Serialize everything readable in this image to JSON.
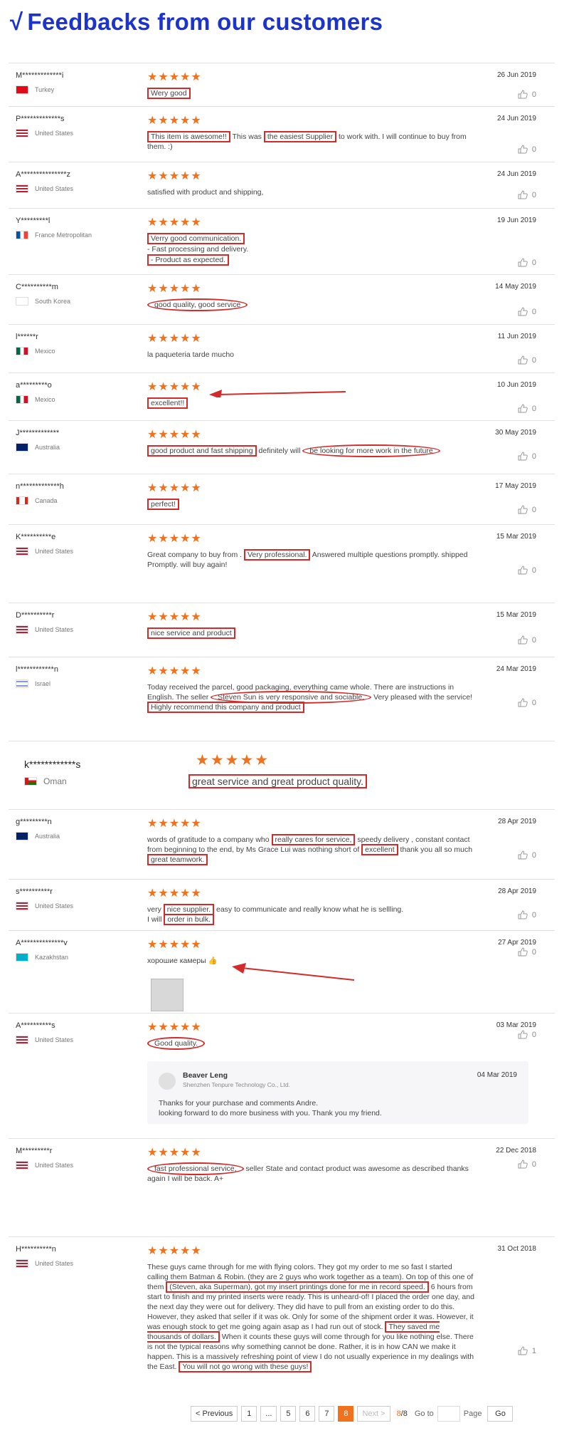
{
  "header": {
    "check": "√",
    "title": "Feedbacks from our customers"
  },
  "stars": "★★★★★",
  "reviews": [
    {
      "user": "M*************i",
      "country": "Turkey",
      "date": "26 Jun 2019",
      "likes": "0",
      "text": "Wery good"
    },
    {
      "user": "P*************s",
      "country": "United States",
      "date": "24 Jun 2019",
      "likes": "0",
      "text_parts": [
        "This item is awesome!!",
        " This was ",
        "the easiest Supplier",
        " to work with. I will continue to buy from them. :)"
      ]
    },
    {
      "user": "A***************z",
      "country": "United States",
      "date": "24 Jun 2019",
      "likes": "0",
      "text": "satisfied with product and shipping,"
    },
    {
      "user": "Y*********l",
      "country": "France Metropolitan",
      "date": "19 Jun 2019",
      "likes": "0",
      "lines": [
        "Verry good communication.",
        "- Fast processing and delivery.",
        "- Product as expected."
      ]
    },
    {
      "user": "C**********m",
      "country": "South Korea",
      "date": "14 May 2019",
      "likes": "0",
      "text": "good quality, good service"
    },
    {
      "user": "l******r",
      "country": "Mexico",
      "date": "11 Jun 2019",
      "likes": "0",
      "text": "la paqueteria tarde mucho"
    },
    {
      "user": "a*********o",
      "country": "Mexico",
      "date": "10 Jun 2019",
      "likes": "0",
      "text": "excellent!!"
    },
    {
      "user": "J*************",
      "country": "Australia",
      "date": "30 May 2019",
      "likes": "0",
      "text_parts": [
        "good product and fast shipping",
        " definitely will ",
        "be looking for more work in the future"
      ]
    },
    {
      "user": "n*************h",
      "country": "Canada",
      "date": "17 May 2019",
      "likes": "0",
      "text": "perfect!"
    },
    {
      "user": "K**********e",
      "country": "United States",
      "date": "15 Mar 2019",
      "likes": "0",
      "text_parts": [
        "Great company to buy from . ",
        "Very professional.",
        " Answered multiple questions promptly. shipped Promptly. will buy again!"
      ]
    },
    {
      "user": "D**********r",
      "country": "United States",
      "date": "15 Mar 2019",
      "likes": "0",
      "text": "nice service and product"
    },
    {
      "user": "l************n",
      "country": "Israel",
      "date": "24 Mar 2019",
      "likes": "0",
      "text_parts": [
        "Today received the parcel, good packaging, everything came whole. There are instructions in English. The seller ",
        "Steven Sun  is very responsive and sociable.",
        " Very pleased with the service! ",
        "Highly recommend this company and product"
      ]
    },
    {
      "user": "k************s",
      "country": "Oman",
      "text": "great service and great product quality."
    },
    {
      "user": "g*********n",
      "country": "Australia",
      "date": "28 Apr 2019",
      "likes": "0",
      "text_parts": [
        "words of gratitude to a company who ",
        "really cares for service,",
        " speedy delivery , constant contact from beginning to the end, by Ms Grace Lui was nothing short of ",
        "excellent",
        " thank you all so much ",
        "great teamwork."
      ]
    },
    {
      "user": "s**********r",
      "country": "United States",
      "date": "28 Apr 2019",
      "likes": "0",
      "text_parts": [
        "very ",
        "nice supplier.",
        " easy to communicate and really know what he is sellling.",
        "I will ",
        "order in bulk."
      ]
    },
    {
      "user": "A**************v",
      "country": "Kazakhstan",
      "date": "27 Apr 2019",
      "likes": "0",
      "text": "хорошие камеры 👍"
    },
    {
      "user": "A**********s",
      "country": "United States",
      "date": "03 Mar 2019",
      "likes": "0",
      "text": "Good quality."
    },
    {
      "user": "M*********r",
      "country": "United States",
      "date": "22 Dec 2018",
      "likes": "0",
      "text_parts": [
        "fast professional service,",
        " seller State and contact product was awesome as described thanks again I will be back. A+"
      ]
    },
    {
      "user": "H**********n",
      "country": "United States",
      "date": "31 Oct 2018",
      "likes": "1",
      "text_parts": [
        "These guys came through for me with flying colors. They got my order to me so fast I started calling them Batman & Robin. (they are 2 guys who work together as a team). On top of this one of them ",
        "(Steven, aka Superman), got my insert printings done for me in record speed.",
        " 6 hours from start to finish and my printed inserts were ready. This is unheard-of! I placed the order one day, and the next day they were out for delivery. They did have to pull from an existing order to do this. However, they asked that seller if it was ok. Only for some of the shipment order it was. However, it was enough stock to get me going again asap as I had run out of stock. ",
        "They saved me thousands of dollars.",
        " When it counts these guys will come through for you like nothing else. There is not the typical reasons why something cannot be done. Rather, it is in how CAN we make it happen. This is a massively refreshing point of view I do not usually experience in my dealings with the East. ",
        "You will not go wrong with these guys!"
      ]
    }
  ],
  "reply": {
    "name": "Beaver Leng",
    "company": "Shenzhen Tenpure Technology Co., Ltd.",
    "date": "04 Mar 2019",
    "lines": [
      "Thanks for your purchase and comments Andre.",
      "looking forward to do more business with you. Thank you my friend."
    ]
  },
  "pagination": {
    "previous": "Previous",
    "pages": [
      "1",
      "...",
      "5",
      "6",
      "7",
      "8"
    ],
    "next": "Next",
    "info_current": "8",
    "info_total": "/8",
    "goto": "Go to",
    "page": "Page",
    "go": "Go"
  }
}
